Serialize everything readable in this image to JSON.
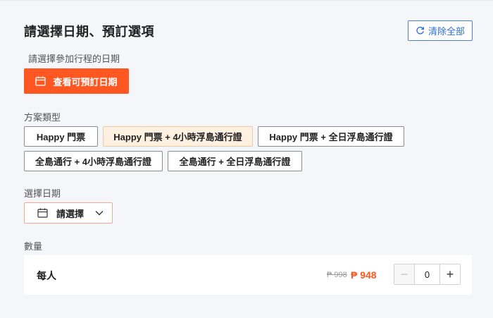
{
  "header": {
    "title": "請選擇日期、預訂選項",
    "clear_all_label": "清除全部"
  },
  "date_prompt": {
    "label": "請選擇參加行程的日期",
    "button_label": "查看可預訂日期"
  },
  "package": {
    "label": "方案類型",
    "options": [
      {
        "label": "Happy 門票",
        "selected": false
      },
      {
        "label": "Happy 門票 + 4小時浮島通行證",
        "selected": true
      },
      {
        "label": "Happy 門票 + 全日浮島通行證",
        "selected": false
      },
      {
        "label": "全島通行 + 4小時浮島通行證",
        "selected": false
      },
      {
        "label": "全島通行 + 全日浮島通行證",
        "selected": false
      }
    ]
  },
  "date_select": {
    "label": "選擇日期",
    "placeholder": "請選擇"
  },
  "quantity": {
    "label": "數量",
    "unit_label": "每人",
    "original_price": "₱ 998",
    "price": "₱ 948",
    "value": "0",
    "minus": "−",
    "plus": "+"
  },
  "colors": {
    "accent": "#ff5722",
    "link": "#2f6fd6",
    "selected_bg": "#fff1e2"
  },
  "icons": [
    "refresh-icon",
    "calendar-icon",
    "chevron-down-icon"
  ]
}
